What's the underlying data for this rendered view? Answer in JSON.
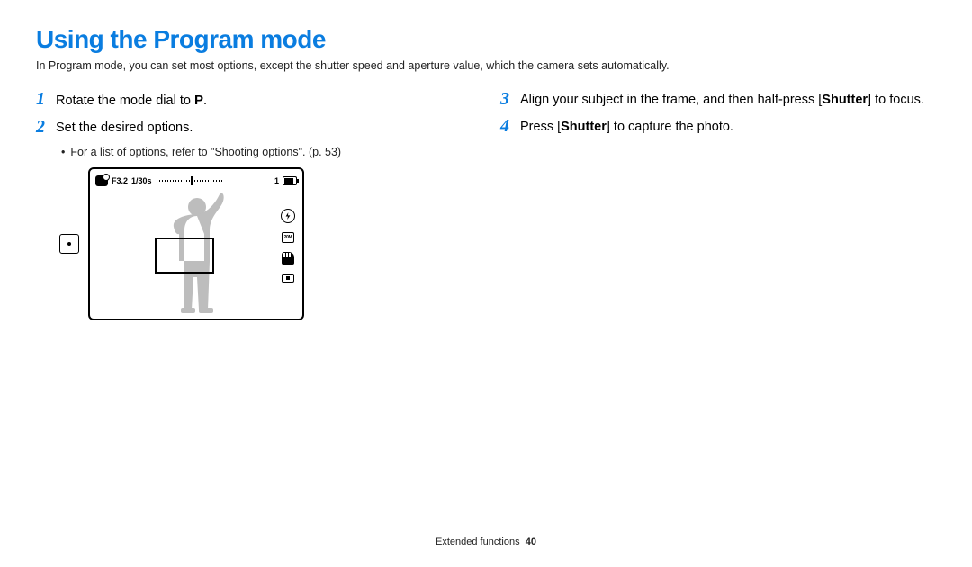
{
  "title": "Using the Program mode",
  "intro": "In Program mode, you can set most options, except the shutter speed and aperture value, which the camera sets automatically.",
  "steps": {
    "s1": {
      "num": "1",
      "pre": "Rotate the mode dial to ",
      "mode_symbol": "P",
      "post": "."
    },
    "s2": {
      "num": "2",
      "text": "Set the desired options.",
      "bullet": "For a list of options, refer to \"Shooting options\". (p. 53)"
    },
    "s3": {
      "num": "3",
      "pre": "Align your subject in the frame, and then half-press [",
      "bold": "Shutter",
      "post": "] to focus."
    },
    "s4": {
      "num": "4",
      "pre": "Press [",
      "bold": "Shutter",
      "post": "] to capture the photo."
    }
  },
  "lcd": {
    "aperture": "F3.2",
    "shutter": "1/30s",
    "shots_left": "1"
  },
  "footer": {
    "section": "Extended functions",
    "page": "40"
  }
}
